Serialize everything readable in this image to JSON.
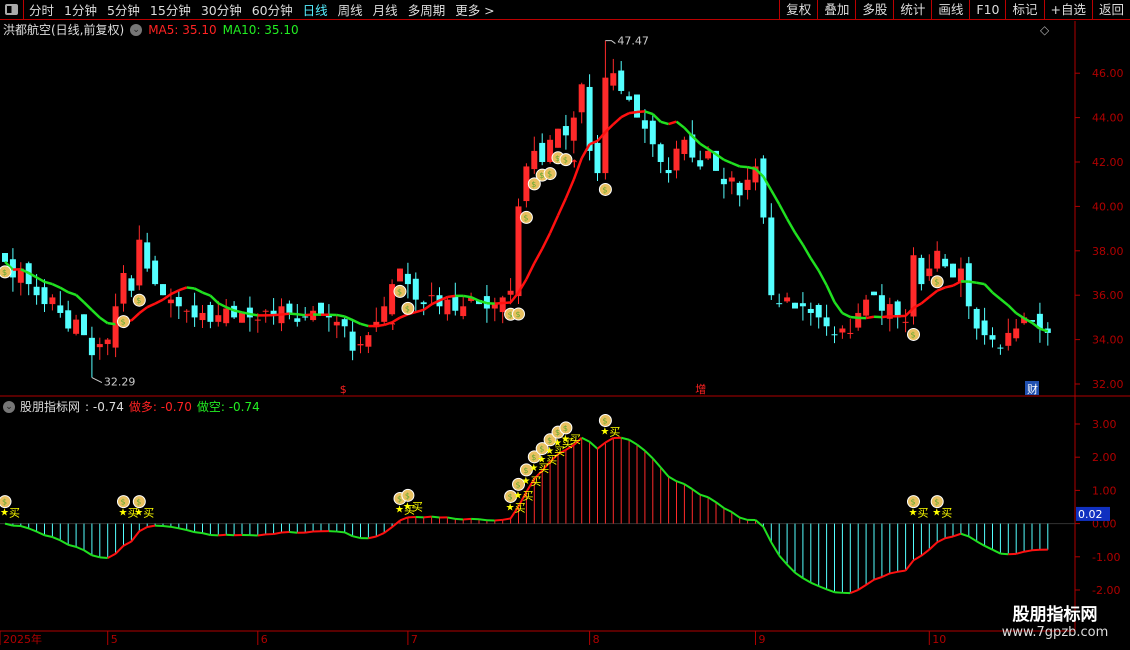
{
  "toolbar": {
    "tabs": [
      "分时",
      "1分钟",
      "5分钟",
      "15分钟",
      "30分钟",
      "60分钟",
      "日线",
      "周线",
      "月线",
      "多周期",
      "更多 >"
    ],
    "active": 6,
    "right_buttons": [
      "复权",
      "叠加",
      "多股",
      "统计",
      "画线",
      "F10",
      "标记",
      "+自选",
      "返回"
    ]
  },
  "main": {
    "title": "洪都航空(日线,前复权)",
    "ma5": "MA5: 35.10",
    "ma10": "MA10: 35.10",
    "max_label": "47.47",
    "min_label": "32.29",
    "price_ticks": [
      "46.00",
      "44.00",
      "42.00",
      "40.00",
      "38.00",
      "36.00",
      "34.00",
      "32.00"
    ],
    "events": [
      "$",
      "增",
      "财"
    ]
  },
  "indicator": {
    "name": "股朋指标网",
    "value": ": -0.74",
    "long": "做多: -0.70",
    "short": "做空: -0.74",
    "current": "0.02",
    "ticks": [
      "3.00",
      "2.00",
      "1.00",
      "0.00",
      "-1.00",
      "-2.00"
    ],
    "buy_label": "买"
  },
  "dates": [
    {
      "label": "2025年",
      "i": 0
    },
    {
      "label": "5",
      "i": 13
    },
    {
      "label": "6",
      "i": 32
    },
    {
      "label": "7",
      "i": 51
    },
    {
      "label": "8",
      "i": 74
    },
    {
      "label": "9",
      "i": 95
    },
    {
      "label": "10",
      "i": 117
    }
  ],
  "watermark": {
    "title": "股朋指标网",
    "url": "www.7gpzb.com"
  },
  "colors": {
    "up": "#ff2a2a",
    "down": "#54ffff",
    "ma_up": "#ff1010",
    "ma_down": "#20e020",
    "axis": "#b00000"
  },
  "chart_data": {
    "type": "candlestick",
    "high_value": 47.47,
    "low_value": 32.29,
    "closes": [
      37.5,
      36.8,
      37.2,
      36.5,
      36.0,
      35.6,
      35.9,
      35.2,
      34.5,
      34.9,
      34.2,
      33.3,
      33.8,
      34.0,
      35.5,
      37.0,
      36.2,
      38.5,
      37.2,
      36.5,
      36.0,
      35.8,
      35.5,
      35.3,
      35.0,
      35.2,
      34.8,
      35.1,
      35.4,
      35.0,
      35.2,
      35.0,
      34.9,
      35.3,
      35.1,
      35.5,
      35.2,
      34.8,
      35.0,
      35.3,
      35.1,
      35.0,
      34.8,
      34.6,
      33.5,
      33.8,
      34.2,
      34.8,
      35.5,
      36.5,
      37.2,
      36.5,
      35.8,
      35.6,
      36.0,
      35.5,
      35.8,
      35.3,
      35.5,
      35.9,
      35.6,
      35.4,
      35.6,
      35.9,
      36.2,
      40.0,
      41.8,
      42.5,
      42.0,
      43.0,
      43.5,
      43.2,
      44.0,
      45.5,
      42.5,
      41.5,
      45.8,
      46.0,
      45.2,
      44.8,
      44.0,
      43.5,
      42.8,
      42.0,
      41.5,
      42.6,
      43.0,
      42.2,
      41.8,
      42.5,
      41.6,
      41.0,
      41.3,
      40.5,
      41.2,
      41.8,
      39.5,
      36.0,
      35.6,
      35.9,
      35.4,
      35.5,
      35.2,
      35.0,
      34.6,
      34.2,
      34.5,
      34.3,
      35.2,
      35.8,
      36.0,
      35.3,
      35.6,
      35.0,
      34.8,
      37.8,
      36.5,
      37.2,
      38.0,
      37.3,
      36.8,
      37.2,
      35.5,
      34.5,
      34.2,
      34.0,
      33.6,
      34.3,
      34.5,
      35.0,
      34.8,
      34.5,
      34.3
    ],
    "buy_signals": [
      0,
      15,
      17,
      50,
      51,
      64,
      65,
      66,
      67,
      68,
      69,
      70,
      71,
      76,
      115,
      118
    ],
    "up_arrows": [
      65,
      66,
      67,
      68,
      69,
      70,
      71,
      72,
      49
    ]
  }
}
